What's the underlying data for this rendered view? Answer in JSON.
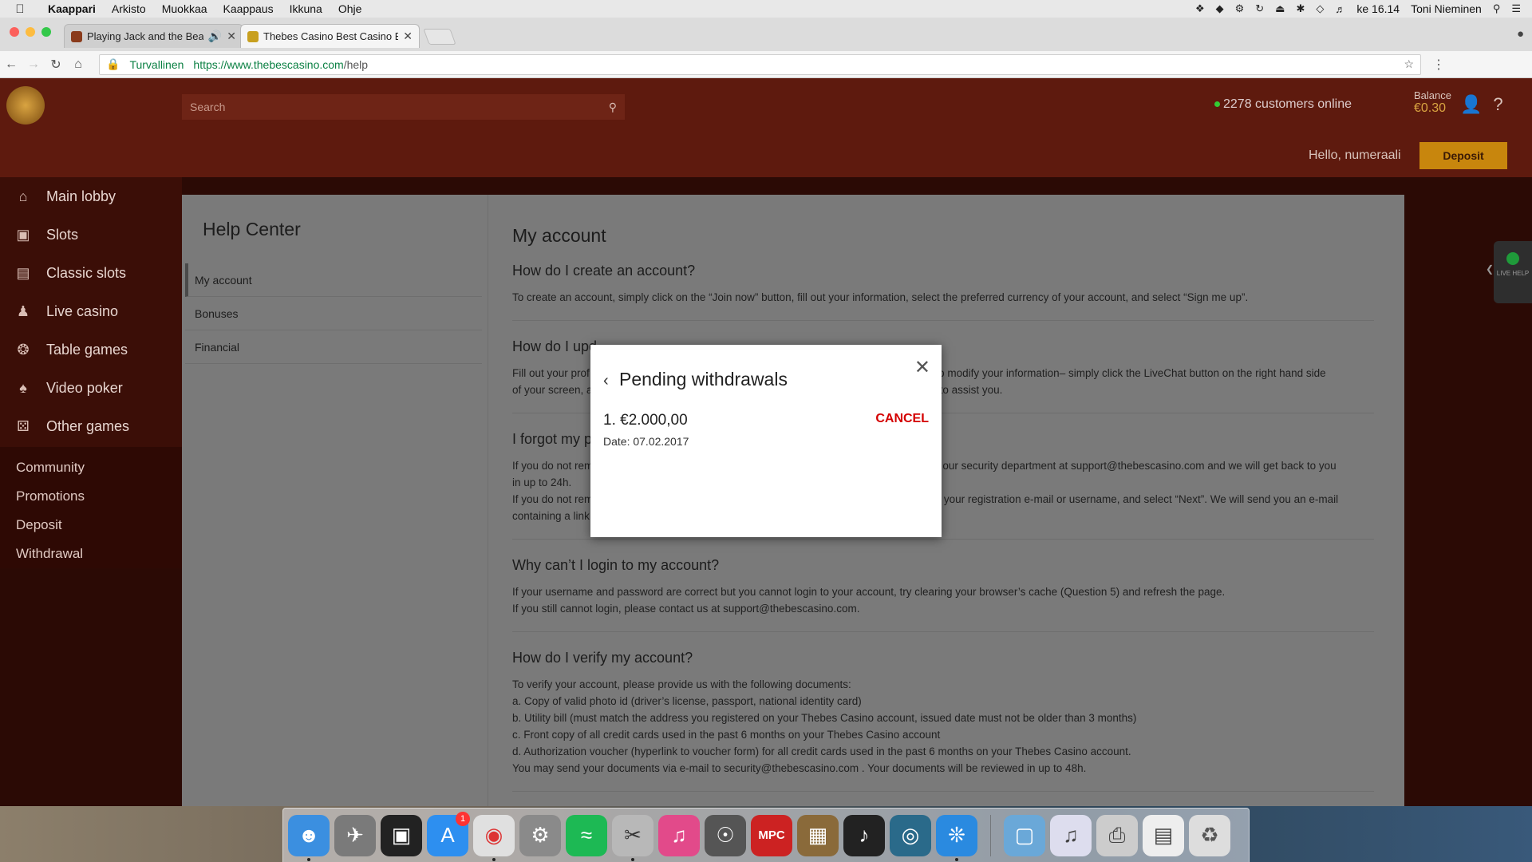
{
  "menubar": {
    "app": "Kaappari",
    "items": [
      "Arkisto",
      "Muokkaa",
      "Kaappaus",
      "Ikkuna",
      "Ohje"
    ],
    "clock": "ke 16.14",
    "user": "Toni Nieminen"
  },
  "browser": {
    "tabs": [
      {
        "title": "Playing Jack and the Beans",
        "favicon_color": "#8a3b1c"
      },
      {
        "title": "Thebes Casino Best Casino B",
        "favicon_color": "#c8a020"
      }
    ],
    "secure_label": "Turvallinen",
    "url_host": "https://www.thebescasino.com",
    "url_path": "/help"
  },
  "site": {
    "search_placeholder": "Search",
    "online": "2278 customers online",
    "balance_label": "Balance",
    "balance_amount": "€0.30",
    "hello": "Hello, numeraali",
    "deposit_button": "Deposit",
    "sidebar": {
      "items": [
        {
          "label": "Main lobby",
          "icon": "home-icon"
        },
        {
          "label": "Slots",
          "icon": "slot-machine-icon"
        },
        {
          "label": "Classic slots",
          "icon": "classic-slots-icon"
        },
        {
          "label": "Live casino",
          "icon": "dealer-icon"
        },
        {
          "label": "Table games",
          "icon": "roulette-icon"
        },
        {
          "label": "Video poker",
          "icon": "cards-icon"
        },
        {
          "label": "Other games",
          "icon": "dice-icon"
        }
      ],
      "links": [
        "Community",
        "Promotions",
        "Deposit",
        "Withdrawal"
      ]
    },
    "help": {
      "title": "Help Center",
      "nav": [
        "My account",
        "Bonuses",
        "Financial"
      ],
      "section_title": "My account",
      "faqs": [
        {
          "q": "How do I create an account?",
          "a": [
            "To create an account, simply click on the “Join now” button, fill out your information, select the preferred currency of your account, and select “Sign me up”."
          ]
        },
        {
          "q": "How do I upd",
          "a": [
            "Fill out your prof                                                                                                              ish to modify your information– simply click the LiveChat button on the right hand side",
            "of your screen, a                                                                                                                    to assist you."
          ]
        },
        {
          "q": "I forgot my p",
          "a": [
            "If you do not rem                                                                                                              tact our security department at support@thebescasino.com and we will get back to you",
            "in up to 24h.",
            "If you do not rem                                                                                                              nter your registration e-mail or username, and select “Next”. We will send you an e-mail",
            "containing a link"
          ]
        },
        {
          "q": "Why can’t I login to my account?",
          "a": [
            "If your username and password are correct but you cannot login to your account, try clearing your browser’s cache (Question 5) and refresh the page.",
            "If you still cannot login, please contact us at support@thebescasino.com."
          ]
        },
        {
          "q": "How do I verify my account?",
          "a": [
            "To verify your account, please provide us with the following documents:",
            "a. Copy of valid photo id (driver’s license, passport, national identity card)",
            "b. Utility bill (must match the address you registered on your Thebes Casino account, issued date must not be older than 3 months)",
            "c. Front copy of all credit cards used in the past 6 months on your Thebes Casino account",
            "d. Authorization voucher (hyperlink to voucher form) for all credit cards used in the past 6 months on your Thebes Casino account.",
            "You may send your documents via e-mail to security@thebescasino.com . Your documents will be reviewed in up to 48h."
          ]
        }
      ]
    },
    "live_help": "LIVE HELP"
  },
  "modal": {
    "title": "Pending withdrawals",
    "amount": "1. €2.000,00",
    "cancel_label": "CANCEL",
    "date": "Date: 07.02.2017"
  },
  "dock": {
    "badge": "1",
    "apps": [
      {
        "name": "finder-icon",
        "color": "#3b8fe0"
      },
      {
        "name": "launchpad-icon",
        "color": "#7a7a7a"
      },
      {
        "name": "photo-booth-icon",
        "color": "#222"
      },
      {
        "name": "app-store-icon",
        "color": "#2d8ff0"
      },
      {
        "name": "chrome-icon",
        "color": "#e0e0e0"
      },
      {
        "name": "system-preferences-icon",
        "color": "#8a8a8a"
      },
      {
        "name": "spotify-icon",
        "color": "#1db954"
      },
      {
        "name": "preview-icon",
        "color": "#b8b8b8"
      },
      {
        "name": "itunes-icon",
        "color": "#e24a8a"
      },
      {
        "name": "disk-utility-icon",
        "color": "#555"
      },
      {
        "name": "mpc-icon",
        "color": "#c22"
      },
      {
        "name": "calculator-icon",
        "color": "#8a6a3a"
      },
      {
        "name": "logic-icon",
        "color": "#222"
      },
      {
        "name": "mainstage-icon",
        "color": "#2a6a8a"
      },
      {
        "name": "safari-icon",
        "color": "#2a8ae0"
      }
    ],
    "right_apps": [
      {
        "name": "applications-folder-icon",
        "color": "#6aa8d8"
      },
      {
        "name": "mp3-file-icon",
        "color": "#dde"
      },
      {
        "name": "printer-icon",
        "color": "#ccc"
      },
      {
        "name": "screenshot-file-icon",
        "color": "#eee"
      },
      {
        "name": "trash-icon",
        "color": "#ddd"
      }
    ]
  }
}
